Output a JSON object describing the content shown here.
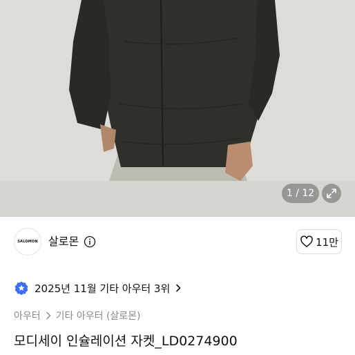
{
  "gallery": {
    "counter": "1 / 12"
  },
  "seller": {
    "logo_text": "SALOMON",
    "name": "살로몬",
    "likes": "11만"
  },
  "ranking": {
    "text": "2025년 11월 기타 아우터 3위"
  },
  "breadcrumb": {
    "items": [
      "아우터",
      "기타 아우터 (살로몬)"
    ]
  },
  "product": {
    "title": "모디세이 인슐레이션 자켓_LD0274900"
  },
  "colors": {
    "badge": "#3b6ef5",
    "jacket": "#2e2e28",
    "background": "#d9d8d3"
  }
}
